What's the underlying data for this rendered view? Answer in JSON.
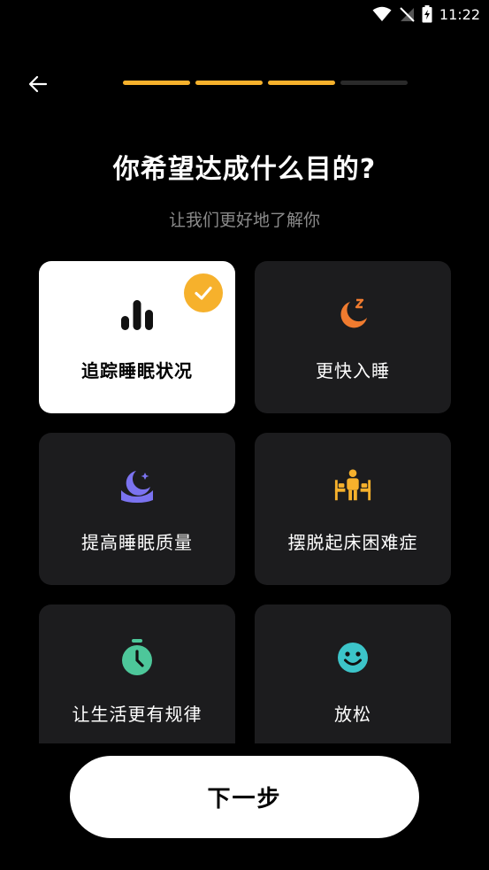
{
  "status_bar": {
    "time": "11:22"
  },
  "header": {
    "progress": {
      "completed": 3,
      "total": 4
    }
  },
  "page": {
    "title": "你希望达成什么目的?",
    "subtitle": "让我们更好地了解你"
  },
  "options": [
    {
      "label": "追踪睡眠状况",
      "icon": "bar-chart-icon",
      "selected": true
    },
    {
      "label": "更快入睡",
      "icon": "moon-zzz-icon",
      "selected": false
    },
    {
      "label": "提高睡眠质量",
      "icon": "moon-pillow-icon",
      "selected": false
    },
    {
      "label": "摆脱起床困难症",
      "icon": "person-bed-icon",
      "selected": false
    },
    {
      "label": "让生活更有规律",
      "icon": "stopwatch-icon",
      "selected": false
    },
    {
      "label": "放松",
      "icon": "smiley-icon",
      "selected": false
    }
  ],
  "footer": {
    "next_label": "下一步"
  },
  "colors": {
    "accent": "#F6B12C",
    "card_bg": "#1c1c1e",
    "orange": "#F07B2F",
    "purple": "#7B73F0",
    "green": "#4DC79A",
    "teal": "#3CC4C9"
  }
}
